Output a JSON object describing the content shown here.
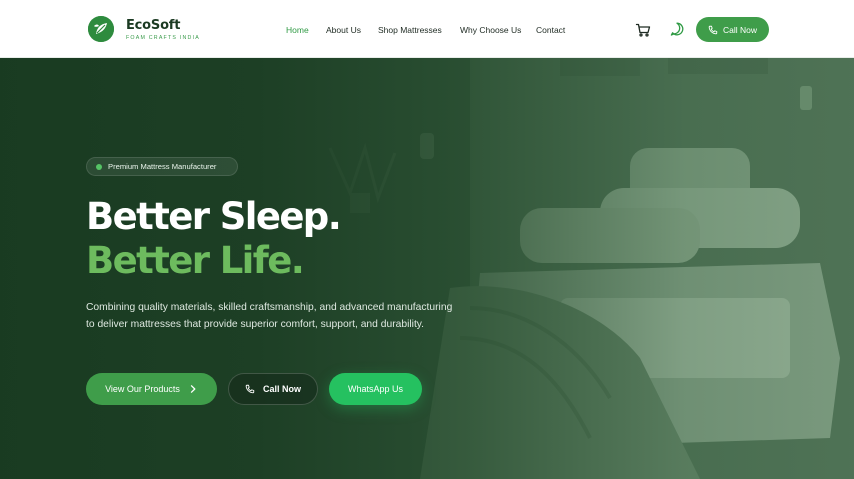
{
  "brand": {
    "name": "EcoSoft",
    "tagline": "FOAM CRAFTS INDIA",
    "color": "#2e8b3e"
  },
  "nav": {
    "items": [
      {
        "label": "Home",
        "active": true
      },
      {
        "label": "About Us",
        "active": false
      },
      {
        "label": "Shop Mattresses",
        "active": false
      },
      {
        "label": "Why Choose Us",
        "active": false
      },
      {
        "label": "Contact",
        "active": false
      }
    ],
    "cart_icon": "shopping-cart-icon",
    "whatsapp_icon": "whatsapp-icon",
    "call_label": "Call Now",
    "call_icon": "phone-icon"
  },
  "hero": {
    "badge": "Premium Mattress Manufacturer",
    "headline_line1": "Better Sleep.",
    "headline_line2": "Better Life.",
    "description": "Combining quality materials, skilled craftsmanship, and advanced manufacturing to deliver mattresses that provide superior comfort, support, and durability.",
    "buttons": {
      "products": "View Our Products",
      "call": "Call Now",
      "whatsapp": "WhatsApp Us"
    }
  },
  "colors": {
    "accent": "#3f9d4a",
    "headline_accent": "#6dbb5e",
    "whatsapp": "#25c160",
    "hero_overlay": "#1b3a22"
  }
}
